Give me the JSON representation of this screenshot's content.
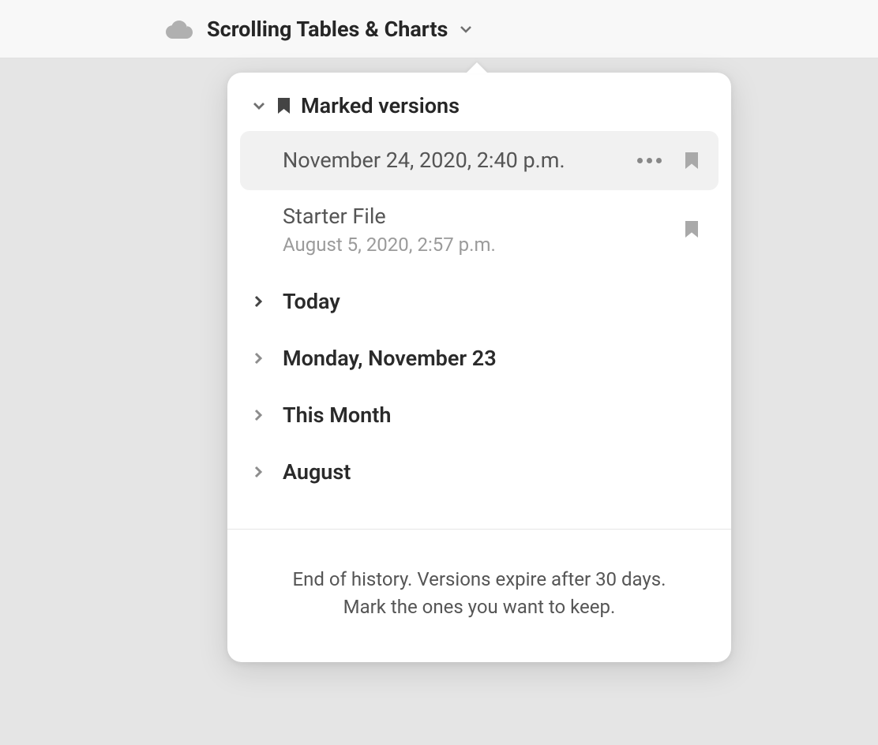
{
  "header": {
    "title": "Scrolling Tables & Charts"
  },
  "popover": {
    "sectionTitle": "Marked versions",
    "markedVersions": [
      {
        "primary": "November 24, 2020, 2:40 p.m.",
        "secondary": ""
      },
      {
        "primary": "Starter File",
        "secondary": "August 5, 2020, 2:57 p.m."
      }
    ],
    "groups": [
      {
        "label": "Today",
        "chevron": "dark"
      },
      {
        "label": "Monday, November 23",
        "chevron": "light"
      },
      {
        "label": "This Month",
        "chevron": "light"
      },
      {
        "label": "August",
        "chevron": "light"
      }
    ],
    "footer": "End of history. Versions expire after 30 days. Mark the ones you want to keep."
  }
}
